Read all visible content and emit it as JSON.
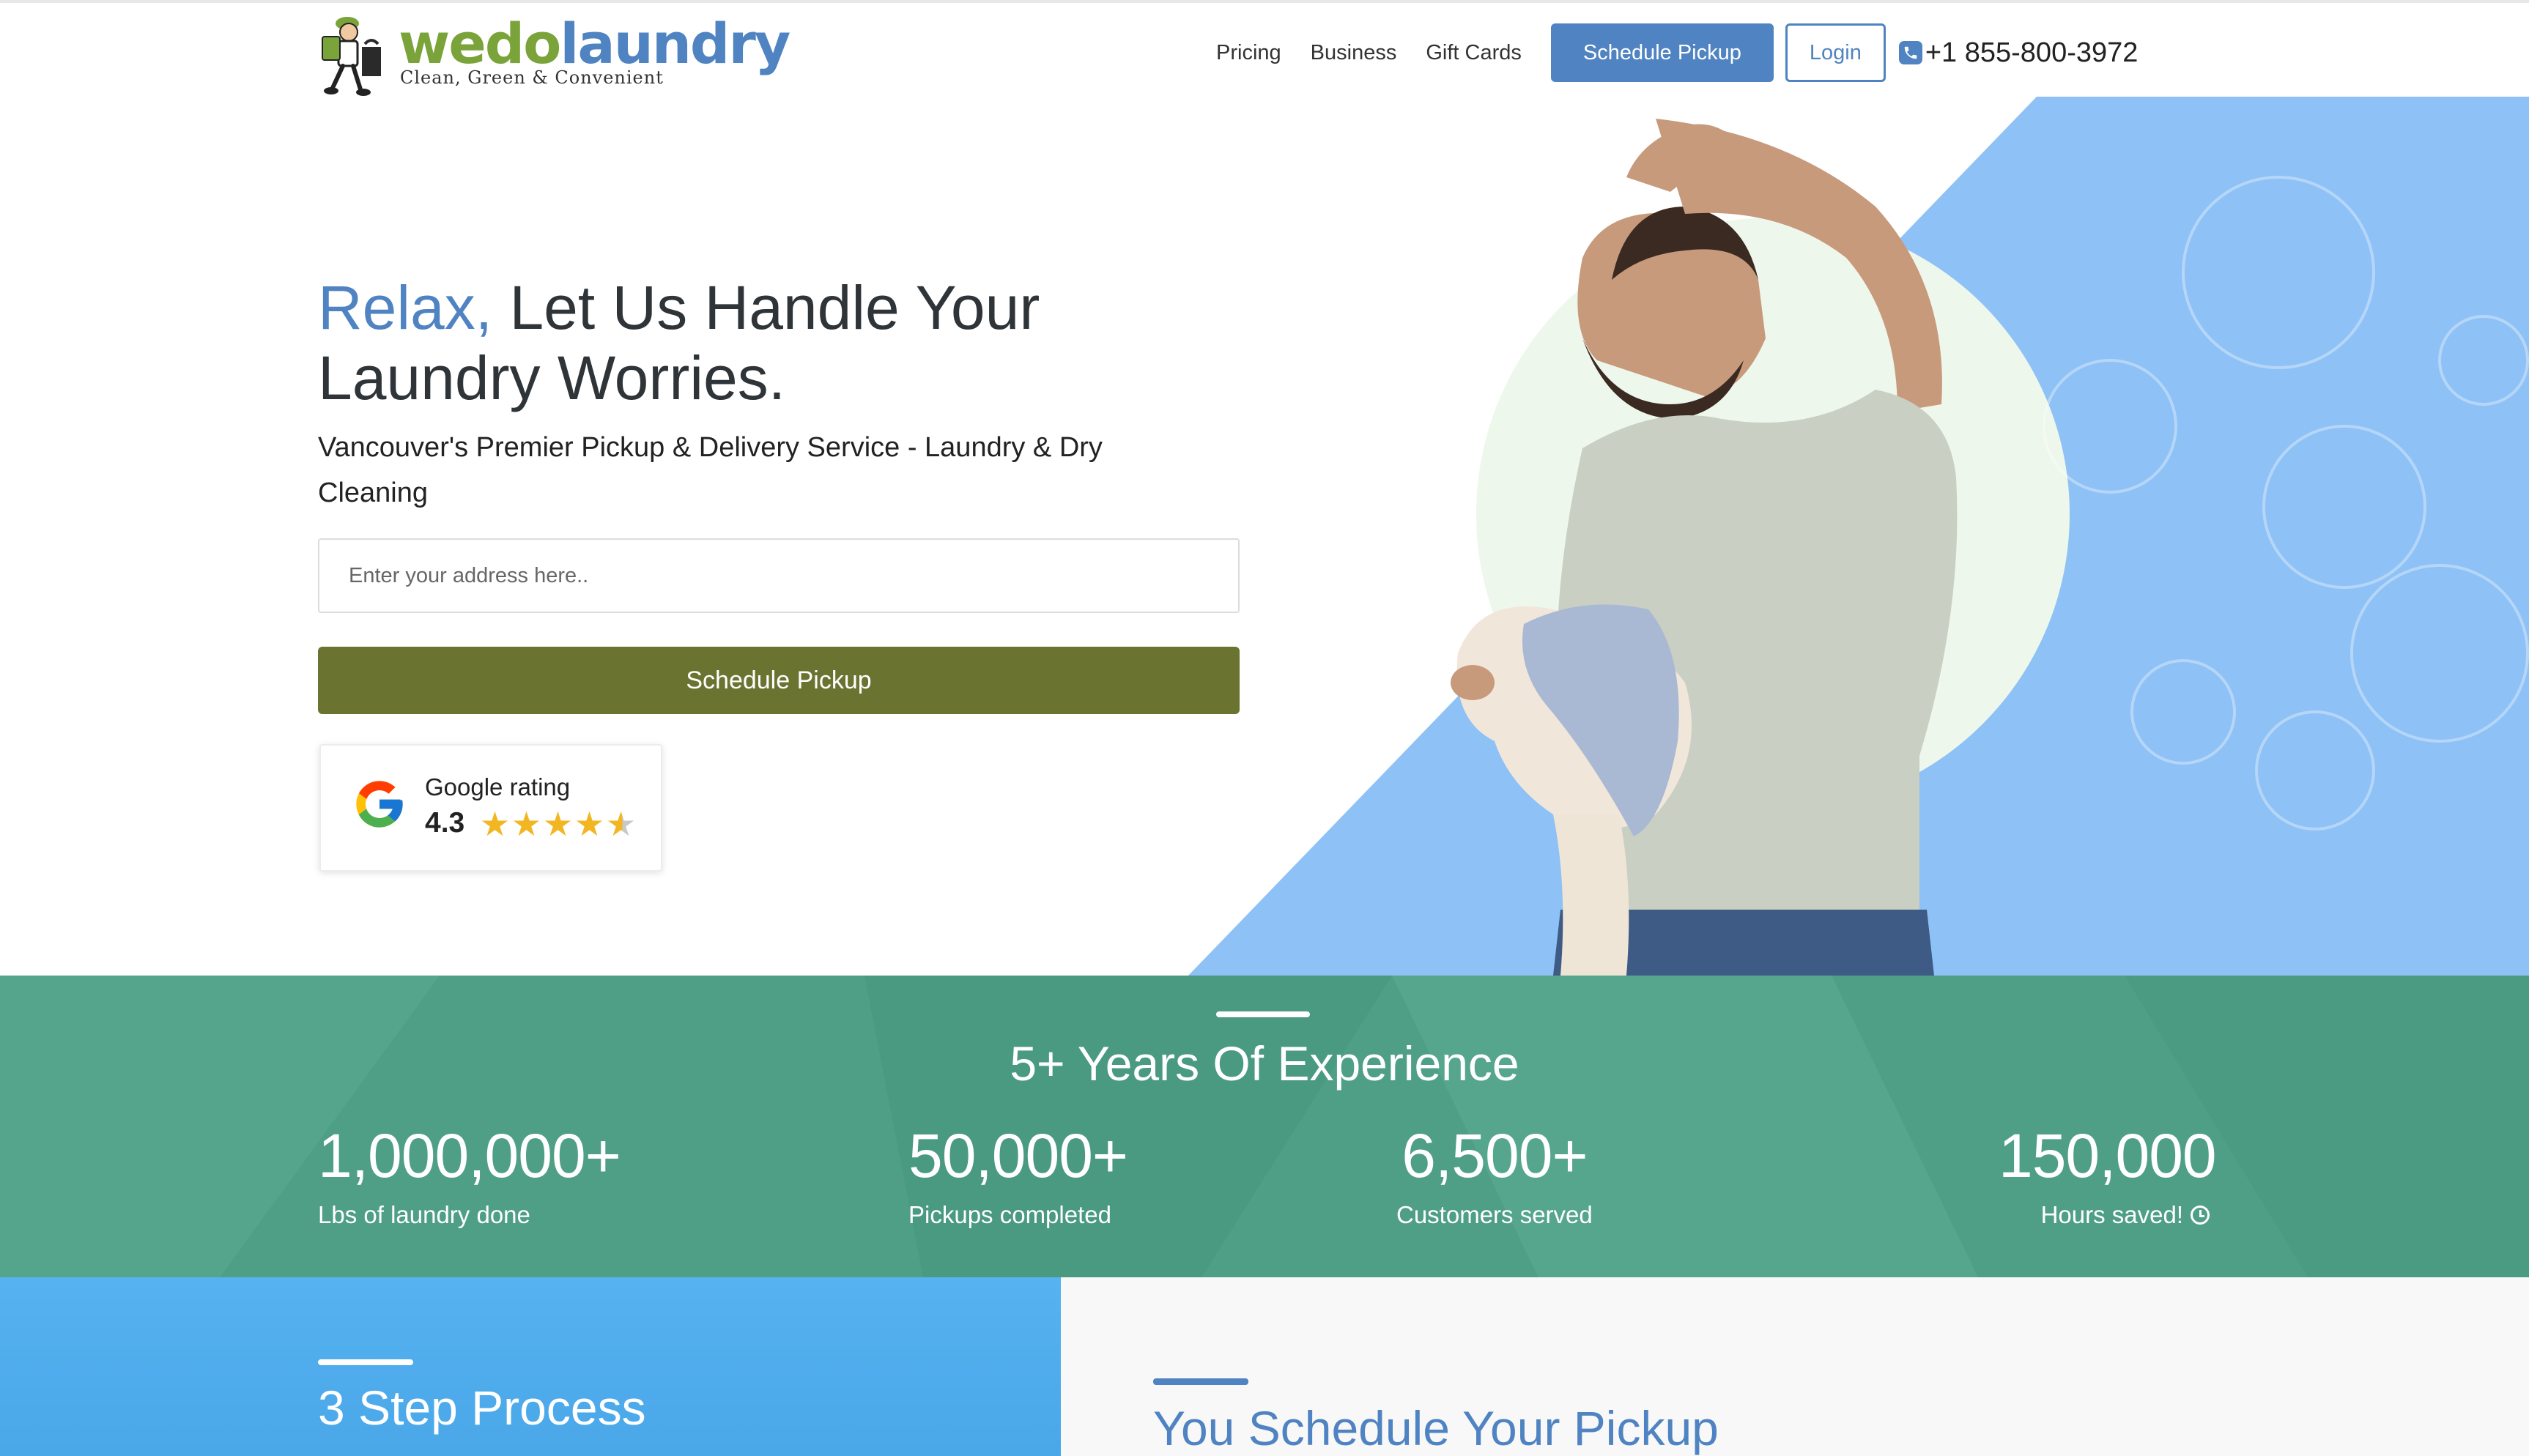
{
  "brand": {
    "name_part1": "wedo",
    "name_part2": "laundry",
    "tagline": "Clean, Green & Convenient"
  },
  "nav": {
    "links": [
      "Pricing",
      "Business",
      "Gift Cards"
    ],
    "schedule_label": "Schedule Pickup",
    "login_label": "Login",
    "phone": "+1 855-800-3972"
  },
  "hero": {
    "title_accent": "Relax,",
    "title_line1_rest": " Let Us Handle Your",
    "title_line2": "Laundry Worries.",
    "subtitle": "Vancouver's Premier Pickup & Delivery Service - Laundry & Dry Cleaning",
    "address_placeholder": "Enter your address here..",
    "schedule_label": "Schedule Pickup"
  },
  "rating": {
    "label": "Google rating",
    "score": "4.3",
    "stars_value": 4.3,
    "stars_max": 5
  },
  "stats": {
    "title": "5+ Years Of Experience",
    "items": [
      {
        "number": "1,000,000+",
        "label": "Lbs of laundry done"
      },
      {
        "number": "50,000+",
        "label": "Pickups completed"
      },
      {
        "number": "6,500+",
        "label": "Customers served"
      },
      {
        "number": "150,000",
        "label": "Hours saved!"
      }
    ]
  },
  "sections": {
    "steps_title": "3 Step Process",
    "schedule_title": "You Schedule Your Pickup"
  },
  "icons": {
    "phone": "phone-icon",
    "google": "google-g-icon",
    "star": "star-icon",
    "clock": "clock-icon"
  },
  "colors": {
    "accent_blue": "#4f83c1",
    "olive_button": "#6a7430",
    "stats_green": "#4f9f86",
    "hero_blue": "#8ec1f5",
    "star_gold": "#f3b623"
  }
}
